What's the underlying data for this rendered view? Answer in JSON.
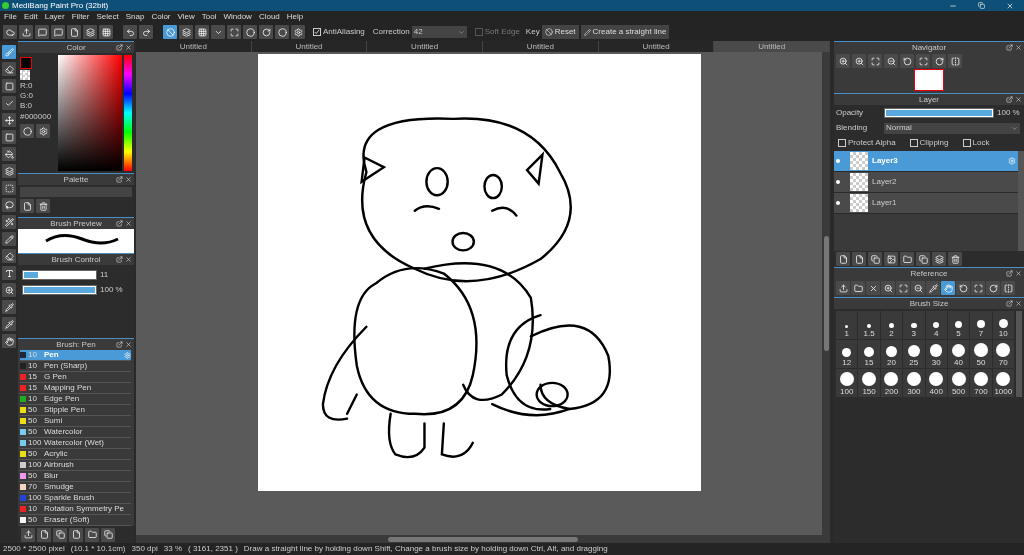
{
  "window": {
    "title": "MediBang Paint Pro (32bit)"
  },
  "menu": [
    "File",
    "Edit",
    "Layer",
    "Filter",
    "Select",
    "Snap",
    "Color",
    "View",
    "Tool",
    "Window",
    "Cloud",
    "Help"
  ],
  "toolbar": {
    "antialiasing": {
      "label": "AntiAliasing",
      "checked": true
    },
    "correction": {
      "label": "Correction",
      "value": "42"
    },
    "soft_edge": {
      "label": "Soft Edge",
      "checked": false,
      "disabled": true
    },
    "key_label": "Key",
    "reset": "Reset",
    "straight_line": "Create a straight line"
  },
  "tabs": [
    {
      "label": "Untitled",
      "selected": false
    },
    {
      "label": "Untitled",
      "selected": false
    },
    {
      "label": "Untitled",
      "selected": false
    },
    {
      "label": "Untitled",
      "selected": false
    },
    {
      "label": "Untitled",
      "selected": false
    },
    {
      "label": "Untitled",
      "selected": true
    }
  ],
  "color_panel": {
    "title": "Color",
    "readout": [
      "R:0",
      "G:0",
      "B:0"
    ],
    "hex": "#000000"
  },
  "palette_panel": {
    "title": "Palette"
  },
  "brush_preview": {
    "title": "Brush Preview"
  },
  "brush_control": {
    "title": "Brush Control",
    "sliders": [
      {
        "level": 0.2,
        "reading": "11"
      },
      {
        "level": 1.0,
        "reading": "100 %"
      }
    ]
  },
  "brush_list": {
    "title": "Brush: Pen",
    "items": [
      {
        "size": "10",
        "name": "Pen",
        "color": "#1f2a3a",
        "selected": true
      },
      {
        "size": "10",
        "name": "Pen (Sharp)",
        "color": "#222222",
        "selected": false
      },
      {
        "size": "15",
        "name": "G Pen",
        "color": "#ee2222",
        "selected": false
      },
      {
        "size": "15",
        "name": "Mapping Pen",
        "color": "#ee2222",
        "selected": false
      },
      {
        "size": "10",
        "name": "Edge Pen",
        "color": "#22aa22",
        "selected": false
      },
      {
        "size": "50",
        "name": "Stipple Pen",
        "color": "#eedd11",
        "selected": false
      },
      {
        "size": "50",
        "name": "Sumi",
        "color": "#eedd11",
        "selected": false
      },
      {
        "size": "50",
        "name": "Watercolor",
        "color": "#77ccee",
        "selected": false
      },
      {
        "size": "100",
        "name": "Watercolor (Wet)",
        "color": "#77ccee",
        "selected": false
      },
      {
        "size": "50",
        "name": "Acrylic",
        "color": "#eedd11",
        "selected": false
      },
      {
        "size": "100",
        "name": "Airbrush",
        "color": "#cccccc",
        "selected": false
      },
      {
        "size": "50",
        "name": "Blur",
        "color": "#ee99ee",
        "selected": false
      },
      {
        "size": "70",
        "name": "Smudge",
        "color": "#f5d5c0",
        "selected": false
      },
      {
        "size": "100",
        "name": "Sparkle Brush",
        "color": "#2244dd",
        "selected": false
      },
      {
        "size": "10",
        "name": "Rotation Symmetry Pe",
        "color": "#ee2222",
        "selected": false
      },
      {
        "size": "50",
        "name": "Eraser (Soft)",
        "color": "#f5f5f5",
        "selected": false
      }
    ]
  },
  "navigator": {
    "title": "Navigator"
  },
  "layer_panel": {
    "title": "Layer",
    "opacity_label": "Opacity",
    "opacity": {
      "level": 1.0,
      "reading": "100 %"
    },
    "blending_label": "Blending",
    "blending": "Normal",
    "options": [
      {
        "label": "Protect Alpha",
        "checked": false
      },
      {
        "label": "Clipping",
        "checked": false
      },
      {
        "label": "Lock",
        "checked": false
      }
    ],
    "layers": [
      {
        "name": "Layer3",
        "selected": true
      },
      {
        "name": "Layer2",
        "selected": false
      },
      {
        "name": "Layer1",
        "selected": false
      }
    ]
  },
  "reference": {
    "title": "Reference"
  },
  "brush_size": {
    "title": "Brush Size",
    "sizes": [
      "1",
      "1.5",
      "2",
      "3",
      "4",
      "5",
      "7",
      "10",
      "12",
      "15",
      "20",
      "25",
      "30",
      "40",
      "50",
      "70",
      "100",
      "150",
      "200",
      "300",
      "400",
      "500",
      "700",
      "1000"
    ]
  },
  "status_bar": {
    "image_size": "2500 * 2500 pixel",
    "physical_size": "(10.1 * 10.1cm)",
    "dpi": "350 dpi",
    "zoom": "33 %",
    "cursor": "( 3161, 2351 )",
    "hint": "Draw a straight line by holding down Shift, Change a brush size by holding down Ctrl, Alt, and dragging"
  }
}
